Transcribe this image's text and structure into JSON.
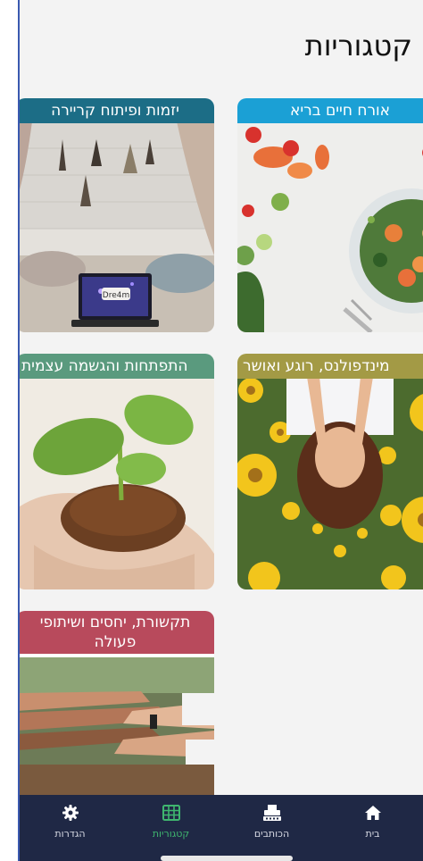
{
  "header": {
    "title": "קטגוריות"
  },
  "categories": [
    {
      "label": "אורח חיים בריא"
    },
    {
      "label": "יזמות ופיתוח קריירה"
    },
    {
      "label": "מינדפולנס, רוגע ואושר"
    },
    {
      "label": "התפתחות והגשמה עצמית"
    },
    {
      "label": "תקשורת, יחסים ושיתופי פעולה"
    }
  ],
  "laptop_screen_text": "Dre4m",
  "nav": {
    "home": "בית",
    "writers": "הכותבים",
    "categories": "קטגוריות",
    "settings": "הגדרות"
  },
  "colors": {
    "nav_background": "#1f2845",
    "nav_active": "#3fb66f",
    "healthy_label": "#1ba0d5",
    "career_label": "#1c6d86",
    "mindfulness_label": "#a39a45",
    "growth_label": "#5a9a7e",
    "relations_label": "#b84a5c"
  }
}
